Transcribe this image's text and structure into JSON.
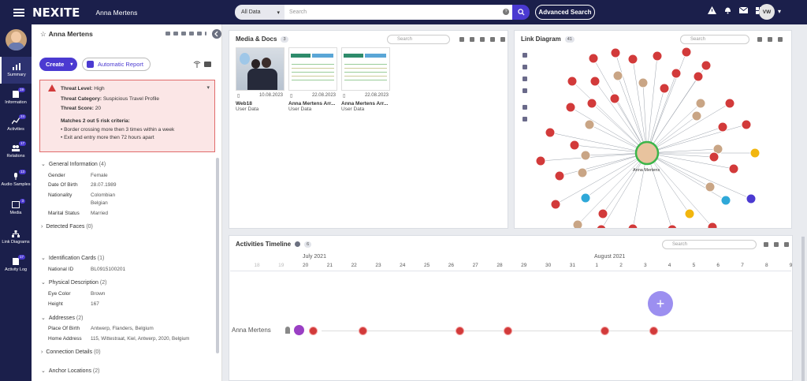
{
  "topbar": {
    "logo": "NEXITE",
    "name": "Anna Mertens",
    "search_scope": "All Data",
    "search_placeholder": "Search",
    "advanced": "Advanced Search",
    "user_initials": "VW"
  },
  "nav": [
    {
      "label": "Summary",
      "badge": ""
    },
    {
      "label": "Information",
      "badge": "19"
    },
    {
      "label": "Activities",
      "badge": "24"
    },
    {
      "label": "Relations",
      "badge": "17"
    },
    {
      "label": "Audio Samples",
      "badge": "13"
    },
    {
      "label": "Media",
      "badge": "3"
    },
    {
      "label": "Link Diagrams",
      "badge": ""
    },
    {
      "label": "Activity Log",
      "badge": "17"
    }
  ],
  "profile": {
    "name": "Anna Mertens",
    "create": "Create",
    "report": "Automatic Report",
    "threat": {
      "level_k": "Threat Level:",
      "level_v": "High",
      "cat_k": "Threat Category:",
      "cat_v": "Suspicious Travel Profile",
      "score_k": "Threat Score:",
      "score_v": "20",
      "matches": "Matches 2 out 5 risk criteria:",
      "c1": "Border crossing more then 3 times within a week",
      "c2": "Exit and entry more then 72 hours apart"
    },
    "sections": {
      "general": "General Information",
      "general_cnt": "(4)",
      "faces": "Detected Faces",
      "faces_cnt": "(0)",
      "idcards": "Identification Cards",
      "idcards_cnt": "(1)",
      "physical": "Physical Description",
      "physical_cnt": "(2)",
      "addresses": "Addresses",
      "addresses_cnt": "(2)",
      "conn": "Connection Details",
      "conn_cnt": "(0)",
      "anchor": "Anchor Locations",
      "anchor_cnt": "(2)"
    },
    "fields": {
      "gender_k": "Gender",
      "gender_v": "Female",
      "dob_k": "Date Of Birth",
      "dob_v": "28.07.1989",
      "nat_k": "Nationality",
      "nat_v1": "Colombian",
      "nat_v2": "Belgian",
      "mar_k": "Marital Status",
      "mar_v": "Married",
      "nid_k": "National ID",
      "nid_v": "BL0915100201",
      "eye_k": "Eye Color",
      "eye_v": "Brown",
      "h_k": "Height",
      "h_v": "167",
      "pob_k": "Place Of Birth",
      "pob_v": "Antwerp, Flanders, Belgium",
      "home_k": "Home Address",
      "home_v": "115, Wittestraat, Kiel, Antwerp, 2020, Belgium"
    }
  },
  "media": {
    "title": "Media & Docs",
    "count": "3",
    "search": "Search",
    "items": [
      {
        "date": "10.08.2023",
        "name": "Web18",
        "type": "User Data"
      },
      {
        "date": "22.08.2023",
        "name": "Anna Mertens Arr...",
        "type": "User Data"
      },
      {
        "date": "22.08.2023",
        "name": "Anna Mertens Arr...",
        "type": "User Data"
      }
    ]
  },
  "link": {
    "title": "Link Diagram",
    "count": "41",
    "search": "Search",
    "center": "Anna Mertens"
  },
  "timeline": {
    "title": "Activities Timeline",
    "count": "6",
    "search": "Search",
    "month1": "July 2021",
    "month2": "August 2021",
    "days": [
      "18",
      "19",
      "20",
      "21",
      "22",
      "23",
      "24",
      "25",
      "26",
      "27",
      "28",
      "29",
      "30",
      "31",
      "1",
      "2",
      "3",
      "4",
      "5",
      "6",
      "7",
      "8",
      "9"
    ],
    "person": "Anna Mertens"
  }
}
